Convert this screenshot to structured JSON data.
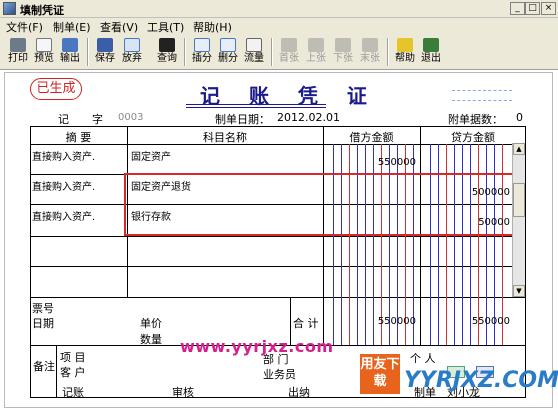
{
  "window": {
    "title": "填制凭证",
    "controls": [
      "_",
      "□",
      "×"
    ]
  },
  "menu": [
    "文件(F)",
    "制单(E)",
    "查看(V)",
    "工具(T)",
    "帮助(H)"
  ],
  "toolbar": {
    "print": "打印",
    "preview": "预览",
    "export": "输出",
    "save": "保存",
    "discard": "放弃",
    "query": "查询",
    "insert": "插分",
    "delete": "删分",
    "flow": "流量",
    "first": "首张",
    "prev": "上张",
    "next": "下张",
    "last": "末张",
    "help": "帮助",
    "exit": "退出"
  },
  "voucher": {
    "status": "已生成",
    "title": "记 账 凭 证",
    "type_label": "记",
    "word_label": "字",
    "number": "0003",
    "date_label": "制单日期：",
    "date": "2012.02.01",
    "attach_label": "附单据数：",
    "attach_count": "0",
    "columns": {
      "summary": "摘 要",
      "account": "科目名称",
      "debit": "借方金额",
      "credit": "贷方金额"
    },
    "rows": [
      {
        "summary": "直接购入资产.",
        "account": "固定资产",
        "debit": "550000",
        "credit": ""
      },
      {
        "summary": "直接购入资产.",
        "account": "固定资产退货",
        "debit": "",
        "credit": "500000"
      },
      {
        "summary": "直接购入资产.",
        "account": "银行存款",
        "debit": "",
        "credit": "50000"
      }
    ],
    "bill_no_label": "票号",
    "date2_label": "日期",
    "unit_price_label": "单价",
    "quantity_label": "数量",
    "total_label": "合 计",
    "total_debit": "550000",
    "total_credit": "550000",
    "remark_label": "备注",
    "project_label": "项  目",
    "department_label": "部  门",
    "customer_label": "客  户",
    "salesman_label": "业务员",
    "personal_label": "个  人",
    "posting_label": "记账",
    "review_label": "审核",
    "cashier_label": "出纳",
    "maker_label": "制单",
    "maker_name": "刘小龙"
  },
  "watermark": {
    "url": "www.yyrjxz.com",
    "logo": "用友下载",
    "logo_text": "YYRJXZ.COM"
  }
}
